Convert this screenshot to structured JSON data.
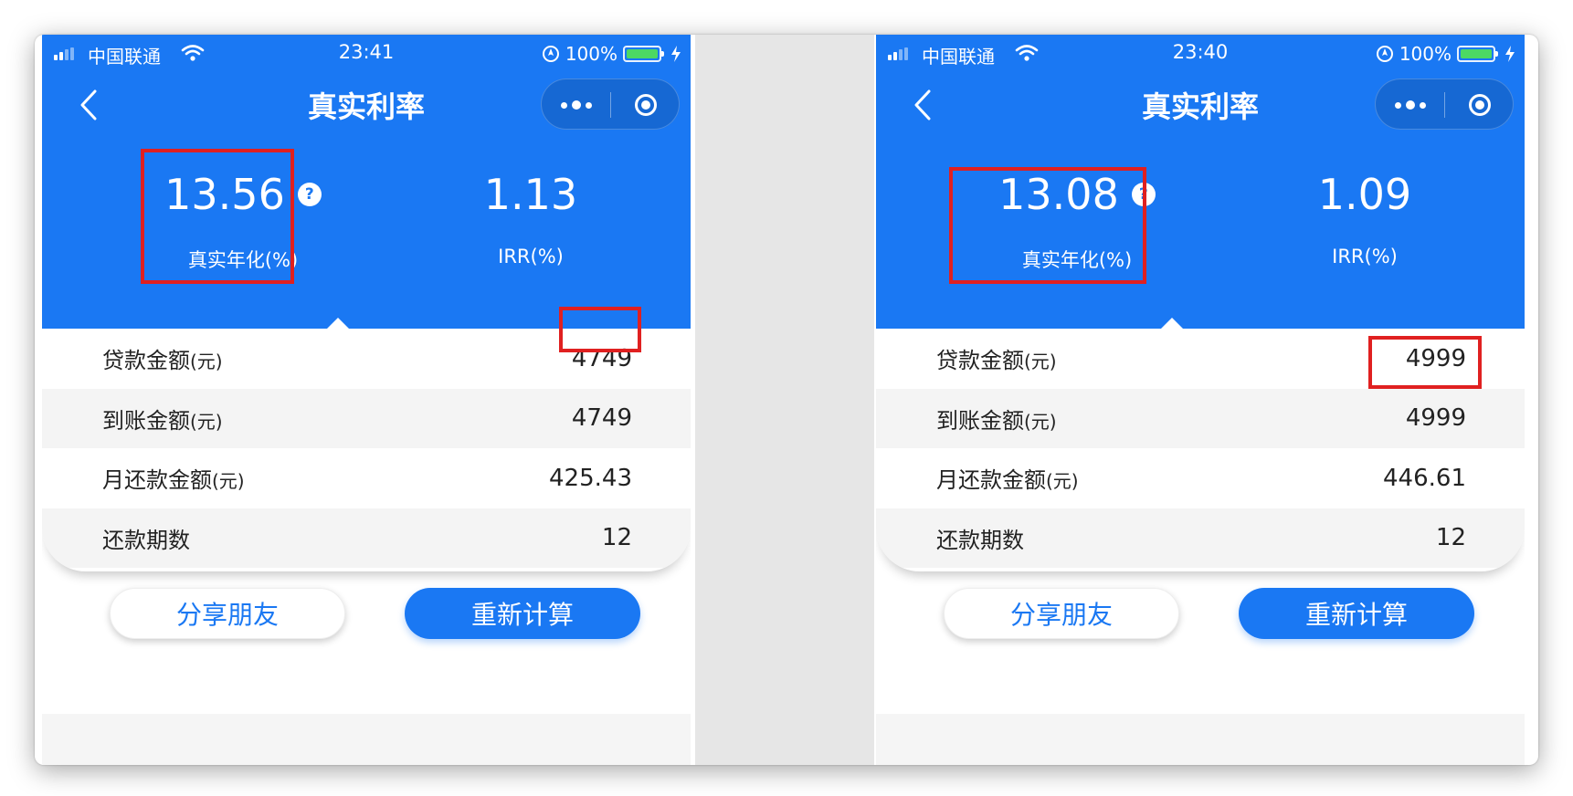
{
  "panels": [
    {
      "carrier": "中国联通",
      "time": "23:41",
      "battery_percent": "100%",
      "title": "真实利率",
      "annual_rate": "13.56",
      "annual_label": "真实年化(%)",
      "irr": "1.13",
      "irr_label": "IRR(%)",
      "rows": [
        {
          "label": "贷款金额",
          "unit": "(元)",
          "value": "4749"
        },
        {
          "label": "到账金额",
          "unit": "(元)",
          "value": "4749"
        },
        {
          "label": "月还款金额",
          "unit": "(元)",
          "value": "425.43"
        },
        {
          "label": "还款期数",
          "unit": "",
          "value": "12"
        }
      ],
      "share_button": "分享朋友",
      "recalc_button": "重新计算"
    },
    {
      "carrier": "中国联通",
      "time": "23:40",
      "battery_percent": "100%",
      "title": "真实利率",
      "annual_rate": "13.08",
      "annual_label": "真实年化(%)",
      "irr": "1.09",
      "irr_label": "IRR(%)",
      "rows": [
        {
          "label": "贷款金额",
          "unit": "(元)",
          "value": "4999"
        },
        {
          "label": "到账金额",
          "unit": "(元)",
          "value": "4999"
        },
        {
          "label": "月还款金额",
          "unit": "(元)",
          "value": "446.61"
        },
        {
          "label": "还款期数",
          "unit": "",
          "value": "12"
        }
      ],
      "share_button": "分享朋友",
      "recalc_button": "重新计算"
    }
  ],
  "help_glyph": "?",
  "colors": {
    "primary_blue": "#1a78f3",
    "highlight_red": "#e02020",
    "battery_green": "#4cd964"
  },
  "icons": [
    "signal-icon",
    "wifi-icon",
    "location-icon",
    "battery-icon",
    "charging-icon",
    "back-chevron-icon",
    "more-icon",
    "target-icon",
    "help-icon"
  ]
}
